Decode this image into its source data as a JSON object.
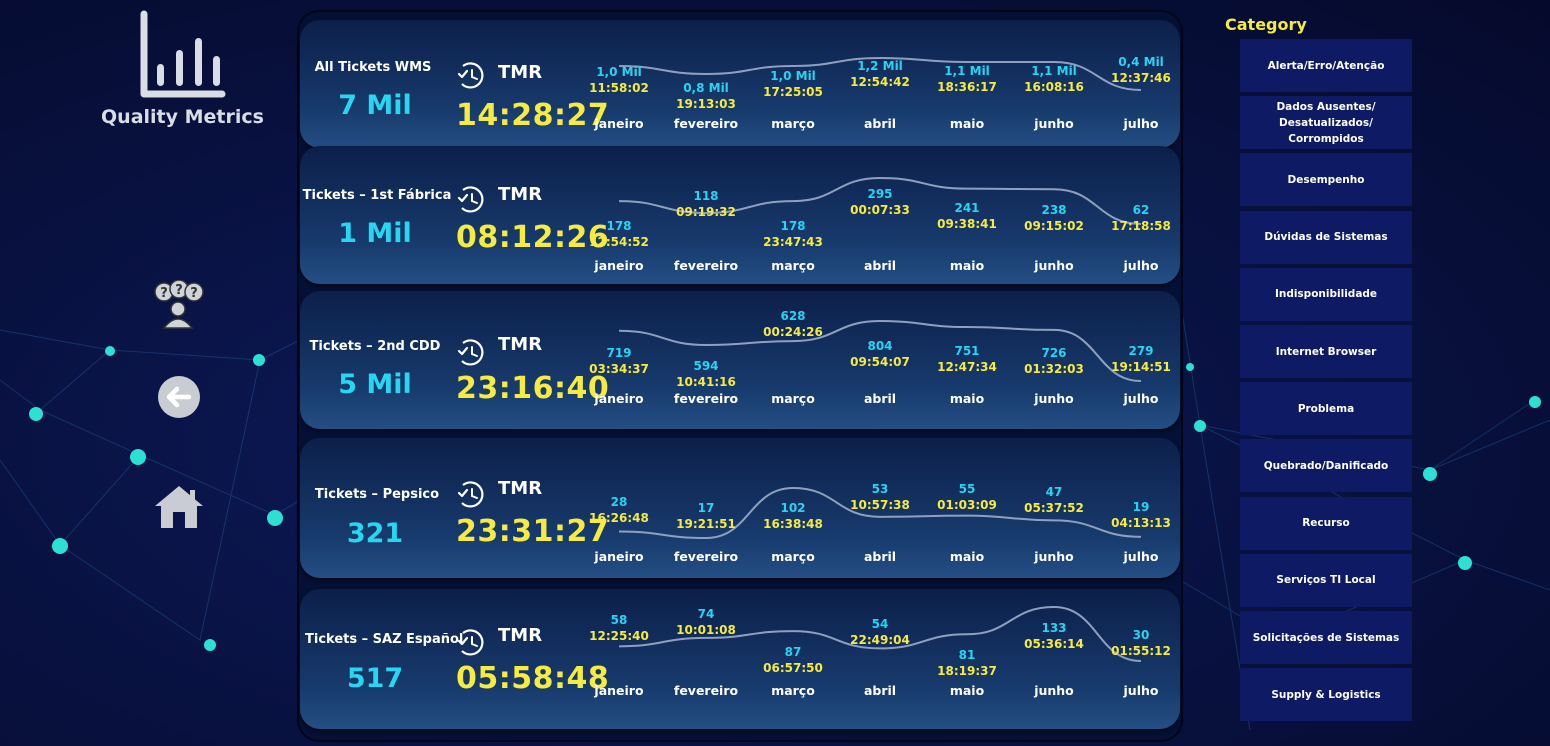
{
  "app": {
    "title": "Quality Metrics"
  },
  "category": {
    "title": "Category",
    "items": [
      "Alerta/Erro/Atenção",
      "Dados Ausentes/ Desatualizados/ Corrompidos",
      "Desempenho",
      "Dúvidas de Sistemas",
      "Indisponibilidade",
      "Internet Browser",
      "Problema",
      "Quebrado/Danificado",
      "Recurso",
      "Serviços TI Local",
      "Solicitações de Sistemas",
      "Supply & Logistics"
    ]
  },
  "colors": {
    "count": "#27d7f2",
    "time": "#f6eb41",
    "category_bg": "#0e1a63",
    "curve": "#8fa0bf"
  },
  "cards": [
    {
      "name": "All Tickets WMS",
      "count": "7 Mil",
      "tmr_label": "TMR",
      "tmr_value": "14:28:27"
    },
    {
      "name": "Tickets – 1st Fábrica",
      "count": "1 Mil",
      "tmr_label": "TMR",
      "tmr_value": "08:12:26"
    },
    {
      "name": "Tickets – 2nd CDD",
      "count": "5 Mil",
      "tmr_label": "TMR",
      "tmr_value": "23:16:40"
    },
    {
      "name": "Tickets – Pepsico",
      "count": "321",
      "tmr_label": "TMR",
      "tmr_value": "23:31:27"
    },
    {
      "name": "Tickets – SAZ Español",
      "count": "517",
      "tmr_label": "TMR",
      "tmr_value": "05:58:48"
    }
  ],
  "chart_data": [
    {
      "type": "line",
      "categories": [
        "janeiro",
        "fevereiro",
        "março",
        "abril",
        "maio",
        "junho",
        "julho"
      ],
      "series": [
        {
          "values": [
            "1,0 Mil",
            "0,8 Mil",
            "1,0 Mil",
            "1,2 Mil",
            "1,1 Mil",
            "1,1 Mil",
            "0,4 Mil"
          ]
        },
        {
          "values": [
            "11:58:02",
            "19:13:03",
            "17:25:05",
            "12:54:42",
            "18:36:17",
            "16:08:16",
            "12:37:46"
          ]
        }
      ]
    },
    {
      "type": "line",
      "categories": [
        "janeiro",
        "fevereiro",
        "março",
        "abril",
        "maio",
        "junho",
        "julho"
      ],
      "series": [
        {
          "values": [
            178,
            118,
            178,
            295,
            241,
            238,
            62
          ]
        },
        {
          "values": [
            "12:54:52",
            "09:19:32",
            "23:47:43",
            "00:07:33",
            "09:38:41",
            "09:15:02",
            "17:18:58"
          ]
        }
      ]
    },
    {
      "type": "line",
      "categories": [
        "janeiro",
        "fevereiro",
        "março",
        "abril",
        "maio",
        "junho",
        "julho"
      ],
      "series": [
        {
          "values": [
            719,
            594,
            628,
            804,
            751,
            726,
            279
          ]
        },
        {
          "values": [
            "03:34:37",
            "10:41:16",
            "00:24:26",
            "09:54:07",
            "12:47:34",
            "01:32:03",
            "19:14:51"
          ]
        }
      ]
    },
    {
      "type": "line",
      "categories": [
        "janeiro",
        "fevereiro",
        "março",
        "abril",
        "maio",
        "junho",
        "julho"
      ],
      "series": [
        {
          "values": [
            28,
            17,
            102,
            53,
            55,
            47,
            19
          ]
        },
        {
          "values": [
            "16:26:48",
            "19:21:51",
            "16:38:48",
            "10:57:38",
            "01:03:09",
            "05:37:52",
            "04:13:13"
          ]
        }
      ]
    },
    {
      "type": "line",
      "categories": [
        "janeiro",
        "fevereiro",
        "março",
        "abril",
        "maio",
        "junho",
        "julho"
      ],
      "series": [
        {
          "values": [
            58,
            74,
            87,
            54,
            81,
            133,
            30
          ]
        },
        {
          "values": [
            "12:25:40",
            "10:01:08",
            "06:57:50",
            "22:49:04",
            "18:19:37",
            "05:36:14",
            "01:55:12"
          ]
        }
      ]
    }
  ]
}
